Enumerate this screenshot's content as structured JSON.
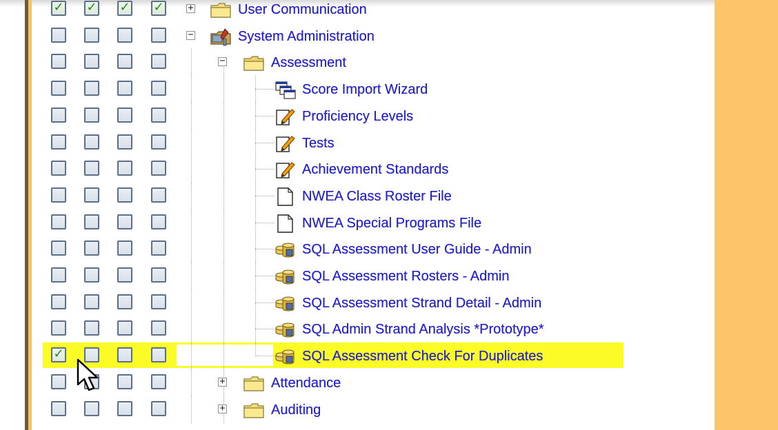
{
  "colors": {
    "link_text": "#2323c8",
    "highlight_row": "#fbfb28",
    "right_panel": "#fdc46a",
    "checkbox_border": "#5c6f86",
    "check_mark": "#1f8a2a"
  },
  "tree": {
    "rows": [
      {
        "label": "User Communication",
        "icon": "folder-icon",
        "expander": "+",
        "checks": [
          true,
          true,
          true,
          true
        ]
      },
      {
        "label": "System Administration",
        "icon": "system-admin-tools-icon",
        "expander": "−",
        "checks": [
          false,
          false,
          false,
          false
        ]
      },
      {
        "label": "Assessment",
        "icon": "folder-open-icon",
        "expander": "−",
        "checks": [
          false,
          false,
          false,
          false
        ]
      },
      {
        "label": "Score Import Wizard",
        "icon": "wizard-windows-icon",
        "checks": [
          false,
          false,
          false,
          false
        ]
      },
      {
        "label": "Proficiency Levels",
        "icon": "edit-form-icon",
        "checks": [
          false,
          false,
          false,
          false
        ]
      },
      {
        "label": "Tests",
        "icon": "edit-form-icon",
        "checks": [
          false,
          false,
          false,
          false
        ]
      },
      {
        "label": "Achievement Standards",
        "icon": "edit-form-icon",
        "checks": [
          false,
          false,
          false,
          false
        ]
      },
      {
        "label": "NWEA Class Roster File",
        "icon": "document-icon",
        "checks": [
          false,
          false,
          false,
          false
        ]
      },
      {
        "label": "NWEA Special Programs File",
        "icon": "document-icon",
        "checks": [
          false,
          false,
          false,
          false
        ]
      },
      {
        "label": "SQL Assessment User Guide - Admin",
        "icon": "database-report-icon",
        "checks": [
          false,
          false,
          false,
          false
        ]
      },
      {
        "label": "SQL Assessment Rosters - Admin",
        "icon": "database-report-icon",
        "checks": [
          false,
          false,
          false,
          false
        ]
      },
      {
        "label": "SQL Assessment Strand Detail - Admin",
        "icon": "database-report-icon",
        "checks": [
          false,
          false,
          false,
          false
        ]
      },
      {
        "label": "SQL Admin Strand Analysis *Prototype*",
        "icon": "database-report-icon",
        "checks": [
          false,
          false,
          false,
          false
        ]
      },
      {
        "label": "SQL Assessment Check For Duplicates",
        "icon": "database-report-icon",
        "checks": [
          true,
          false,
          false,
          false
        ],
        "highlighted": true
      },
      {
        "label": "Attendance",
        "icon": "folder-icon",
        "expander": "+",
        "checks": [
          false,
          false,
          false,
          false
        ]
      },
      {
        "label": "Auditing",
        "icon": "folder-icon",
        "expander": "+",
        "checks": [
          false,
          false,
          false,
          false
        ]
      }
    ]
  }
}
